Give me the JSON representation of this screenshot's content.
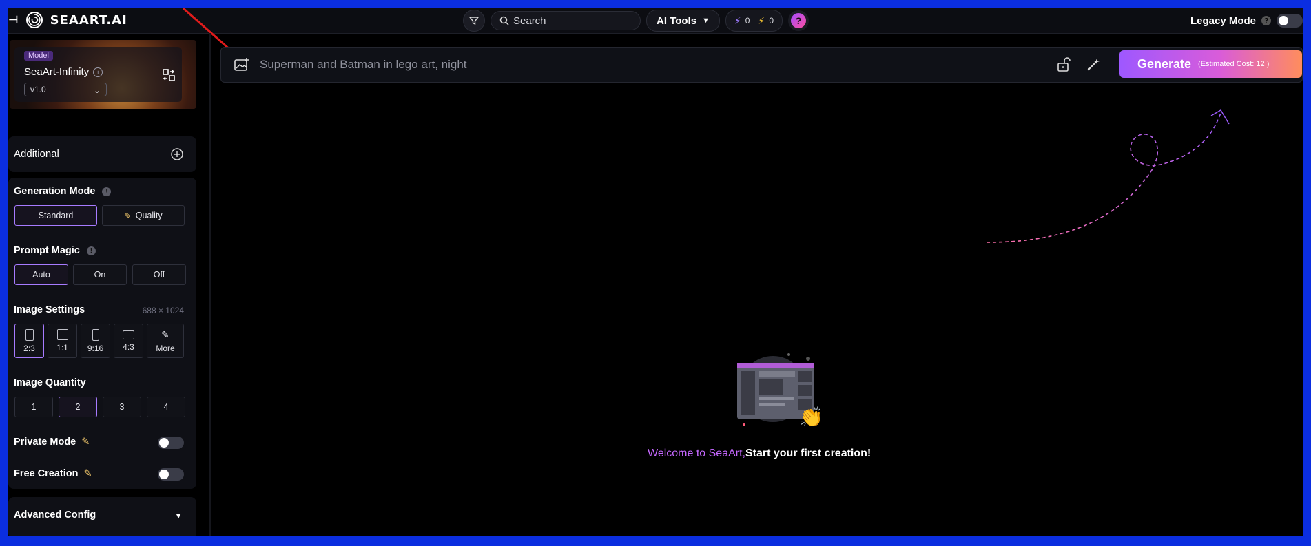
{
  "topbar": {
    "brand": "SEAART.AI",
    "search_placeholder": "Search",
    "ai_tools_label": "AI Tools",
    "credit_a": "0",
    "credit_b": "0",
    "help_label": "?",
    "legacy_label": "Legacy Mode"
  },
  "model": {
    "tag": "Model",
    "name": "SeaArt-Infinity",
    "version": "v1.0"
  },
  "sidebar": {
    "additional_label": "Additional",
    "generation_mode": {
      "title": "Generation Mode",
      "options": [
        "Standard",
        "Quality"
      ],
      "selected": "Standard"
    },
    "prompt_magic": {
      "title": "Prompt Magic",
      "options": [
        "Auto",
        "On",
        "Off"
      ],
      "selected": "Auto"
    },
    "image_settings": {
      "title": "Image Settings",
      "dimensions": "688 × 1024",
      "ratios": [
        "2:3",
        "1:1",
        "9:16",
        "4:3",
        "More"
      ],
      "selected": "2:3"
    },
    "image_quantity": {
      "title": "Image Quantity",
      "options": [
        "1",
        "2",
        "3",
        "4"
      ],
      "selected": "2"
    },
    "private_mode_label": "Private Mode",
    "free_creation_label": "Free Creation",
    "advanced_label": "Advanced Config"
  },
  "prompt": {
    "placeholder": "Superman and Batman in lego art, night",
    "generate_label": "Generate",
    "cost_label": "(Estimated Cost: 12 )"
  },
  "main": {
    "welcome_a": "Welcome to SeaArt,",
    "welcome_b": "Start your first creation!"
  },
  "colors": {
    "accent": "#a77bff",
    "frame": "#0b2ee0",
    "gen_gradient_start": "#9e58ff",
    "gen_gradient_end": "#ff8d5c"
  }
}
